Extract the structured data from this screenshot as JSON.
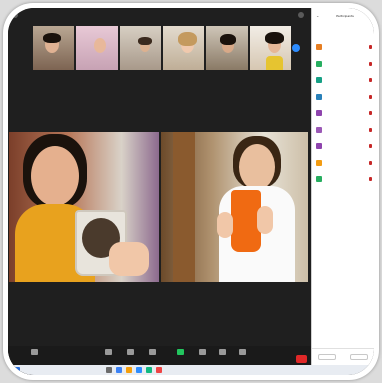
{
  "panel": {
    "title": "Participants",
    "participants": [
      {
        "name": "",
        "color": "#e67e22"
      },
      {
        "name": "",
        "color": "#27ae60"
      },
      {
        "name": "",
        "color": "#16a085"
      },
      {
        "name": "",
        "color": "#2980b9"
      },
      {
        "name": "",
        "color": "#8e44ad"
      },
      {
        "name": "",
        "color": "#9b59b6"
      },
      {
        "name": "",
        "color": "#8e44ad"
      },
      {
        "name": "",
        "color": "#f39c12"
      },
      {
        "name": "",
        "color": "#27ae60"
      }
    ]
  },
  "toolbar": {
    "buttons": [
      {
        "label": "",
        "icon": "mute-icon"
      },
      {
        "label": "",
        "icon": "security-icon"
      },
      {
        "label": "",
        "icon": "participants-icon"
      },
      {
        "label": "",
        "icon": "chat-icon"
      },
      {
        "label": "",
        "icon": "share-screen-icon"
      },
      {
        "label": "",
        "icon": "record-icon"
      },
      {
        "label": "",
        "icon": "breakout-rooms-icon"
      },
      {
        "label": "",
        "icon": "reactions-icon"
      }
    ]
  },
  "colors": {
    "accent": "#2d8cff",
    "end": "#e02828",
    "share": "#22c55e"
  }
}
